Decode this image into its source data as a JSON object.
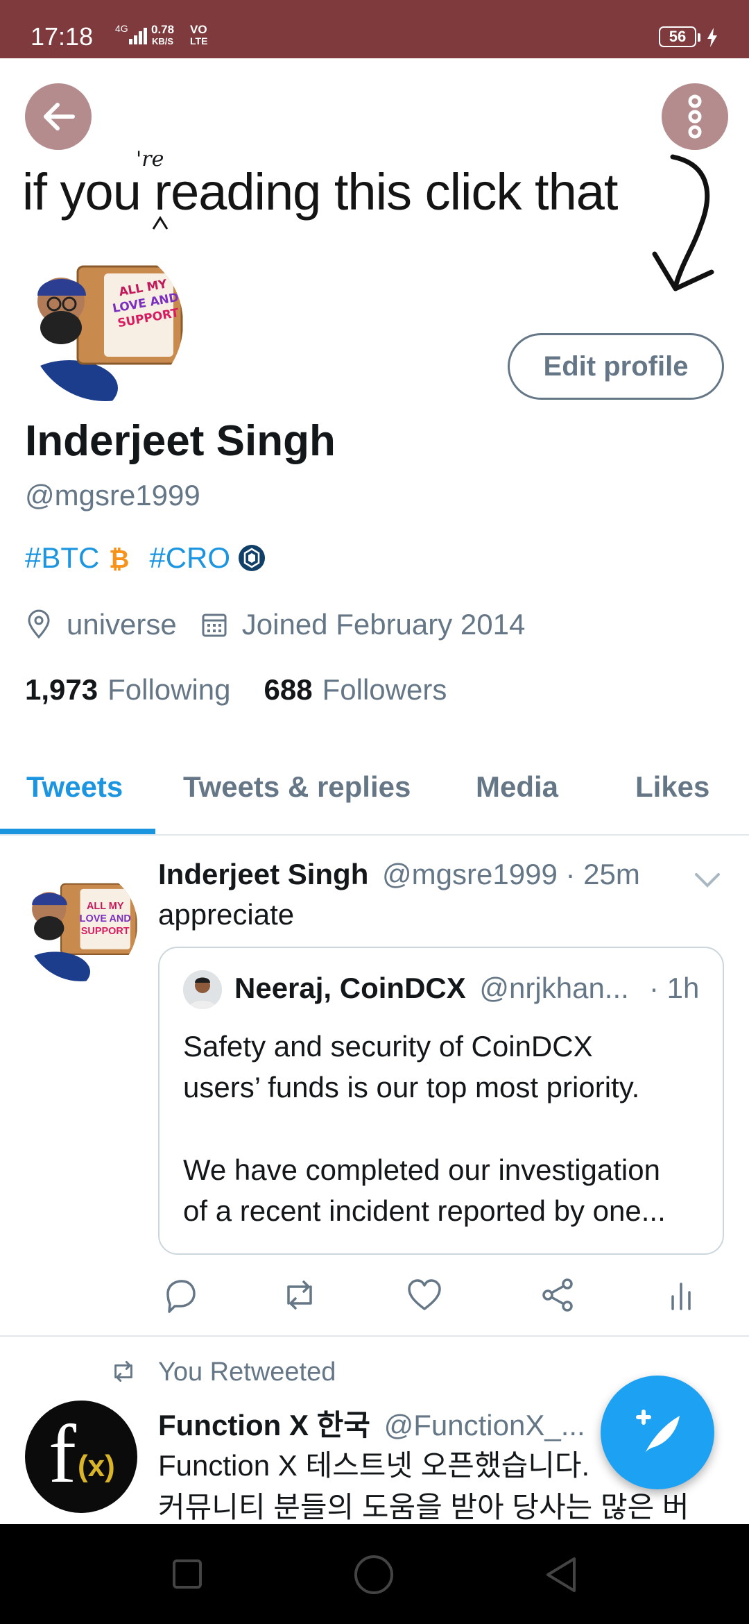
{
  "status_bar": {
    "time": "17:18",
    "network": "4G",
    "speed_value": "0.78",
    "speed_unit": "KB/S",
    "volte_top": "VO",
    "volte_bottom": "LTE",
    "battery": "56"
  },
  "banner": {
    "text": "if you reading this click that",
    "scribble": "'re"
  },
  "avatar": {
    "box_text_1": "ALL MY",
    "box_text_2": "LOVE AND",
    "box_text_3": "SUPPORT"
  },
  "profile": {
    "edit_button": "Edit profile",
    "name": "Inderjeet Singh",
    "handle": "@mgsre1999",
    "bio_tag_1": "#BTC",
    "bio_tag_2": "#CRO",
    "location": "universe",
    "joined": "Joined February 2014",
    "following_count": "1,973",
    "following_label": "Following",
    "followers_count": "688",
    "followers_label": "Followers"
  },
  "tabs": [
    "Tweets",
    "Tweets & replies",
    "Media",
    "Likes"
  ],
  "tweet1": {
    "name": "Inderjeet Singh",
    "handle_time": "@mgsre1999 · 25m",
    "text": "appreciate",
    "quote": {
      "name": "Neeraj, CoinDCX",
      "handle": "@nrjkhan...",
      "time": "· 1h",
      "lines": [
        "Safety and security of CoinDCX",
        "users’ funds is our top most priority.",
        "",
        "We have completed our investigation",
        "of a recent incident reported by one..."
      ]
    }
  },
  "tweet2": {
    "retweet_label": "You Retweeted",
    "name": "Function X 한국",
    "handle": "@FunctionX_...",
    "line1": "Function X 테스트넷 오픈했습니다.",
    "line2": "커뮤니티 분들의 도움을 받아 당사는 많은 버",
    "logo_f": "f",
    "logo_x": "(x)"
  },
  "colors": {
    "accent": "#1b95e0",
    "status_bar": "#7e3a3c",
    "secondary_text": "#657786"
  }
}
